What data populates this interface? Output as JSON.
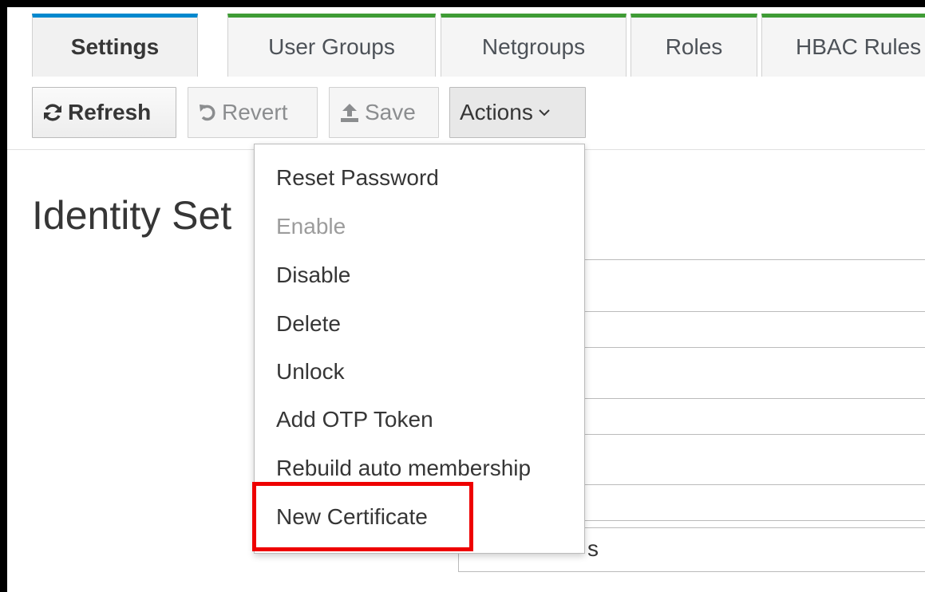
{
  "tabs": [
    {
      "label": "Settings",
      "active": true
    },
    {
      "label": "User Groups"
    },
    {
      "label": "Netgroups"
    },
    {
      "label": "Roles"
    },
    {
      "label": "HBAC Rules"
    }
  ],
  "toolbar": {
    "refresh_label": "Refresh",
    "revert_label": "Revert",
    "save_label": "Save",
    "actions_label": "Actions"
  },
  "page": {
    "title": "Identity Set",
    "partial_field_text": "s"
  },
  "actions_menu": {
    "items": [
      {
        "label": "Reset Password",
        "enabled": true
      },
      {
        "label": "Enable",
        "enabled": false
      },
      {
        "label": "Disable",
        "enabled": true
      },
      {
        "label": "Delete",
        "enabled": true
      },
      {
        "label": "Unlock",
        "enabled": true
      },
      {
        "label": "Add OTP Token",
        "enabled": true
      },
      {
        "label": "Rebuild auto membership",
        "enabled": true
      },
      {
        "label": "New Certificate",
        "enabled": true,
        "highlighted": true
      }
    ]
  },
  "colors": {
    "active_tab_accent": "#0088ce",
    "tab_accent": "#3f9c35",
    "highlight_border": "#ee0000"
  }
}
